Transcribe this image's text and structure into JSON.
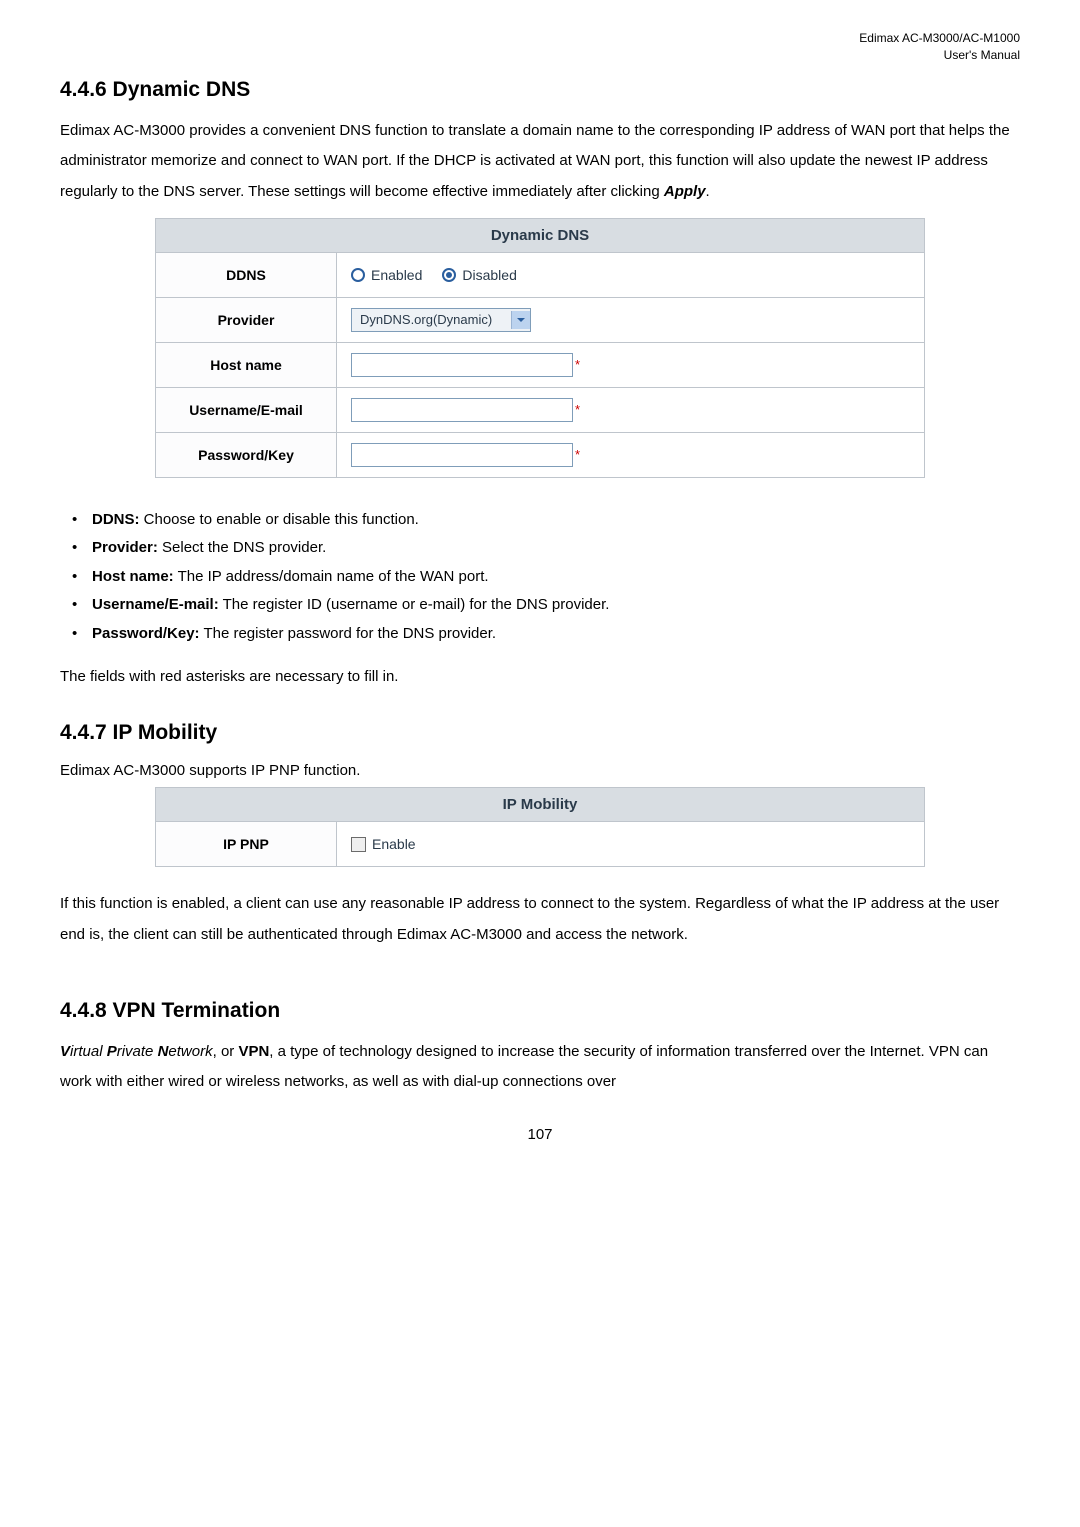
{
  "header": {
    "line1": "Edimax  AC-M3000/AC-M1000",
    "line2": "User's  Manual"
  },
  "section_446": {
    "heading": "4.4.6 Dynamic DNS",
    "intro": "Edimax AC-M3000 provides a convenient DNS function to translate a domain name to the corresponding IP address of WAN port that helps the administrator memorize and connect to WAN port. If the DHCP is activated at WAN port, this function will also update the newest IP address regularly to the DNS server. These settings will become effective immediately after clicking ",
    "intro_emph": "Apply",
    "intro_tail": ".",
    "table": {
      "title": "Dynamic DNS",
      "rows": {
        "ddns_label": "DDNS",
        "ddns_enabled": "Enabled",
        "ddns_disabled": "Disabled",
        "provider_label": "Provider",
        "provider_value": "DynDNS.org(Dynamic)",
        "hostname_label": "Host name",
        "username_label": "Username/E-mail",
        "password_label": "Password/Key"
      }
    },
    "bullets": [
      {
        "label": "DDNS:",
        "text": " Choose to enable or disable this function."
      },
      {
        "label": "Provider:",
        "text": " Select the DNS provider."
      },
      {
        "label": "Host name:",
        "text": " The IP address/domain name of the WAN port."
      },
      {
        "label": "Username/E-mail:",
        "text": " The register ID (username or e-mail) for the DNS provider."
      },
      {
        "label": "Password/Key:",
        "text": " The register password for the DNS provider."
      }
    ],
    "footnote": "The fields with red asterisks are necessary to fill in."
  },
  "section_447": {
    "heading": "4.4.7 IP Mobility",
    "intro": "Edimax AC-M3000 supports IP PNP function.",
    "table": {
      "title": "IP Mobility",
      "row_label": "IP PNP",
      "row_value": "Enable"
    },
    "para": "If this function is enabled, a client can use any reasonable IP address to connect to the system. Regardless of what the IP address at the user end is, the client can still be authenticated through Edimax AC-M3000 and access the network."
  },
  "section_448": {
    "heading": "4.4.8 VPN Termination",
    "intro_parts": {
      "vpn_v": "V",
      "vpn_irtual": "irtual ",
      "vpn_p": "P",
      "vpn_rivate": "rivate ",
      "vpn_n": "N",
      "vpn_etwork": "etwork",
      "mid": ", or ",
      "vpn_bold": "VPN",
      "tail": ", a type of technology designed to increase the security of information transferred over the Internet. VPN can work with either wired or wireless networks, as well as with dial-up connections over"
    }
  },
  "icons": {
    "asterisk": "*"
  },
  "page_number": "107"
}
